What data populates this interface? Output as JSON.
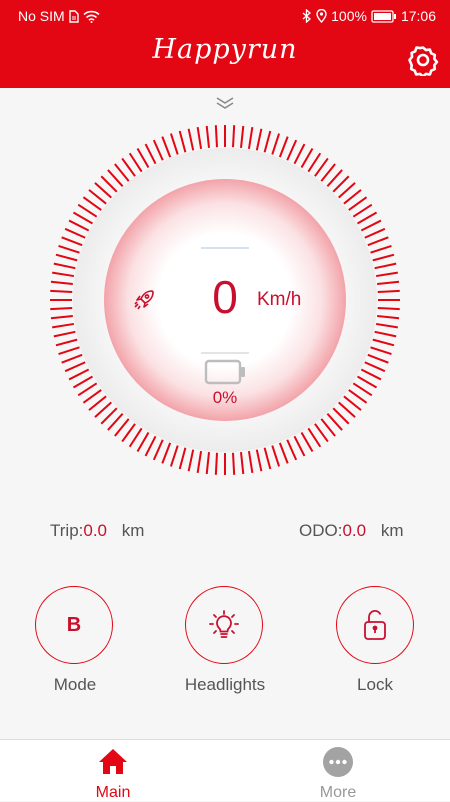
{
  "status_bar": {
    "carrier": "No SIM",
    "battery": "100%",
    "time": "17:06"
  },
  "app_bar": {
    "title": "Happyrun",
    "settings_icon": "gear-icon"
  },
  "gauge": {
    "speed": "0",
    "speed_unit": "Km/h",
    "battery_percent": "0%",
    "mode_icon": "rocket-icon",
    "battery_icon": "battery-icon",
    "accent_color": "#e30613"
  },
  "stats": {
    "trip_label": "Trip:",
    "trip_value": "0.0",
    "trip_unit": "km",
    "odo_label": "ODO:",
    "odo_value": "0.0",
    "odo_unit": "km"
  },
  "actions": {
    "mode_letter": "B",
    "mode_label": "Mode",
    "headlights_label": "Headlights",
    "lock_label": "Lock"
  },
  "nav": {
    "main_label": "Main",
    "more_label": "More",
    "active_color": "#e30613",
    "inactive_color": "#999999"
  }
}
